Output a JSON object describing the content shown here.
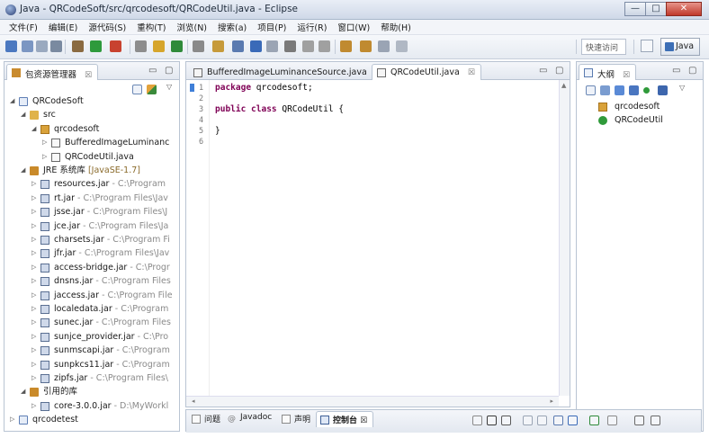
{
  "window": {
    "title": "Java - QRCodeSoft/src/qrcodesoft/QRCodeUtil.java - Eclipse",
    "buttons": {
      "minimize": "—",
      "maximize": "□",
      "close": "✕"
    }
  },
  "menu": [
    "文件(F)",
    "编辑(E)",
    "源代码(S)",
    "重构(T)",
    "浏览(N)",
    "搜索(a)",
    "项目(P)",
    "运行(R)",
    "窗口(W)",
    "帮助(H)"
  ],
  "toolbar": {
    "quick_access": "快速访问",
    "perspective_java": "Java"
  },
  "package_explorer": {
    "title": "包资源管理器",
    "close": "☒",
    "rows": [
      {
        "label": "QRCodeSoft",
        "muted": "",
        "level": 0,
        "twisty": "◢",
        "icon": "project"
      },
      {
        "label": "src",
        "muted": "",
        "level": 1,
        "twisty": "◢",
        "icon": "src-folder"
      },
      {
        "label": "qrcodesoft",
        "muted": "",
        "level": 2,
        "twisty": "◢",
        "icon": "package"
      },
      {
        "label": "BufferedImageLuminanc",
        "muted": "",
        "level": 3,
        "twisty": "▷",
        "icon": "java-file"
      },
      {
        "label": "QRCodeUtil.java",
        "muted": "",
        "level": 3,
        "twisty": "▷",
        "icon": "java-file"
      },
      {
        "label": "JRE 系统库",
        "muted": "[JavaSE-1.7]",
        "level": 1,
        "twisty": "◢",
        "icon": "library"
      },
      {
        "label": "resources.jar",
        "muted": " - C:\\Program",
        "level": 2,
        "twisty": "▷",
        "icon": "jar"
      },
      {
        "label": "rt.jar",
        "muted": " - C:\\Program Files\\Jav",
        "level": 2,
        "twisty": "▷",
        "icon": "jar"
      },
      {
        "label": "jsse.jar",
        "muted": " - C:\\Program Files\\J",
        "level": 2,
        "twisty": "▷",
        "icon": "jar"
      },
      {
        "label": "jce.jar",
        "muted": " - C:\\Program Files\\Ja",
        "level": 2,
        "twisty": "▷",
        "icon": "jar"
      },
      {
        "label": "charsets.jar",
        "muted": " - C:\\Program Fi",
        "level": 2,
        "twisty": "▷",
        "icon": "jar"
      },
      {
        "label": "jfr.jar",
        "muted": " - C:\\Program Files\\Jav",
        "level": 2,
        "twisty": "▷",
        "icon": "jar"
      },
      {
        "label": "access-bridge.jar",
        "muted": " - C:\\Progr",
        "level": 2,
        "twisty": "▷",
        "icon": "jar"
      },
      {
        "label": "dnsns.jar",
        "muted": " - C:\\Program Files",
        "level": 2,
        "twisty": "▷",
        "icon": "jar"
      },
      {
        "label": "jaccess.jar",
        "muted": " - C:\\Program File",
        "level": 2,
        "twisty": "▷",
        "icon": "jar"
      },
      {
        "label": "localedata.jar",
        "muted": " - C:\\Program",
        "level": 2,
        "twisty": "▷",
        "icon": "jar"
      },
      {
        "label": "sunec.jar",
        "muted": " - C:\\Program Files",
        "level": 2,
        "twisty": "▷",
        "icon": "jar"
      },
      {
        "label": "sunjce_provider.jar",
        "muted": " - C:\\Pro",
        "level": 2,
        "twisty": "▷",
        "icon": "jar"
      },
      {
        "label": "sunmscapi.jar",
        "muted": " - C:\\Program",
        "level": 2,
        "twisty": "▷",
        "icon": "jar"
      },
      {
        "label": "sunpkcs11.jar",
        "muted": " - C:\\Program",
        "level": 2,
        "twisty": "▷",
        "icon": "jar"
      },
      {
        "label": "zipfs.jar",
        "muted": " - C:\\Program Files\\",
        "level": 2,
        "twisty": "▷",
        "icon": "jar"
      },
      {
        "label": "引用的库",
        "muted": "",
        "level": 1,
        "twisty": "◢",
        "icon": "library"
      },
      {
        "label": "core-3.0.0.jar",
        "muted": " - D:\\MyWorkl",
        "level": 2,
        "twisty": "▷",
        "icon": "jar"
      },
      {
        "label": "qrcodetest",
        "muted": "",
        "level": 0,
        "twisty": "▷",
        "icon": "project"
      }
    ]
  },
  "editor": {
    "tabs": [
      {
        "label": "BufferedImageLuminanceSource.java",
        "active": false
      },
      {
        "label": "QRCodeUtil.java",
        "active": true,
        "close": "☒"
      }
    ],
    "lines": [
      {
        "num": "1",
        "kw": "package",
        "rest": " qrcodesoft;"
      },
      {
        "num": "2",
        "kw": "",
        "rest": ""
      },
      {
        "num": "3",
        "kw": "public class",
        "rest": " QRCodeUtil {"
      },
      {
        "num": "4",
        "kw": "",
        "rest": ""
      },
      {
        "num": "5",
        "kw": "",
        "rest": "}"
      },
      {
        "num": "6",
        "kw": "",
        "rest": ""
      }
    ]
  },
  "outline": {
    "title": "大纲",
    "close": "☒",
    "items": [
      {
        "label": "qrcodesoft",
        "icon": "package"
      },
      {
        "label": "QRCodeUtil",
        "icon": "class"
      }
    ]
  },
  "bottom_panel": {
    "tabs": [
      {
        "label": "问题",
        "active": false
      },
      {
        "label": "Javadoc",
        "active": false
      },
      {
        "label": "声明",
        "active": false
      },
      {
        "label": "控制台",
        "active": true,
        "close": "☒"
      }
    ]
  },
  "colors": {
    "keyword": "#7f0055",
    "accent": "#3f7fd8"
  }
}
